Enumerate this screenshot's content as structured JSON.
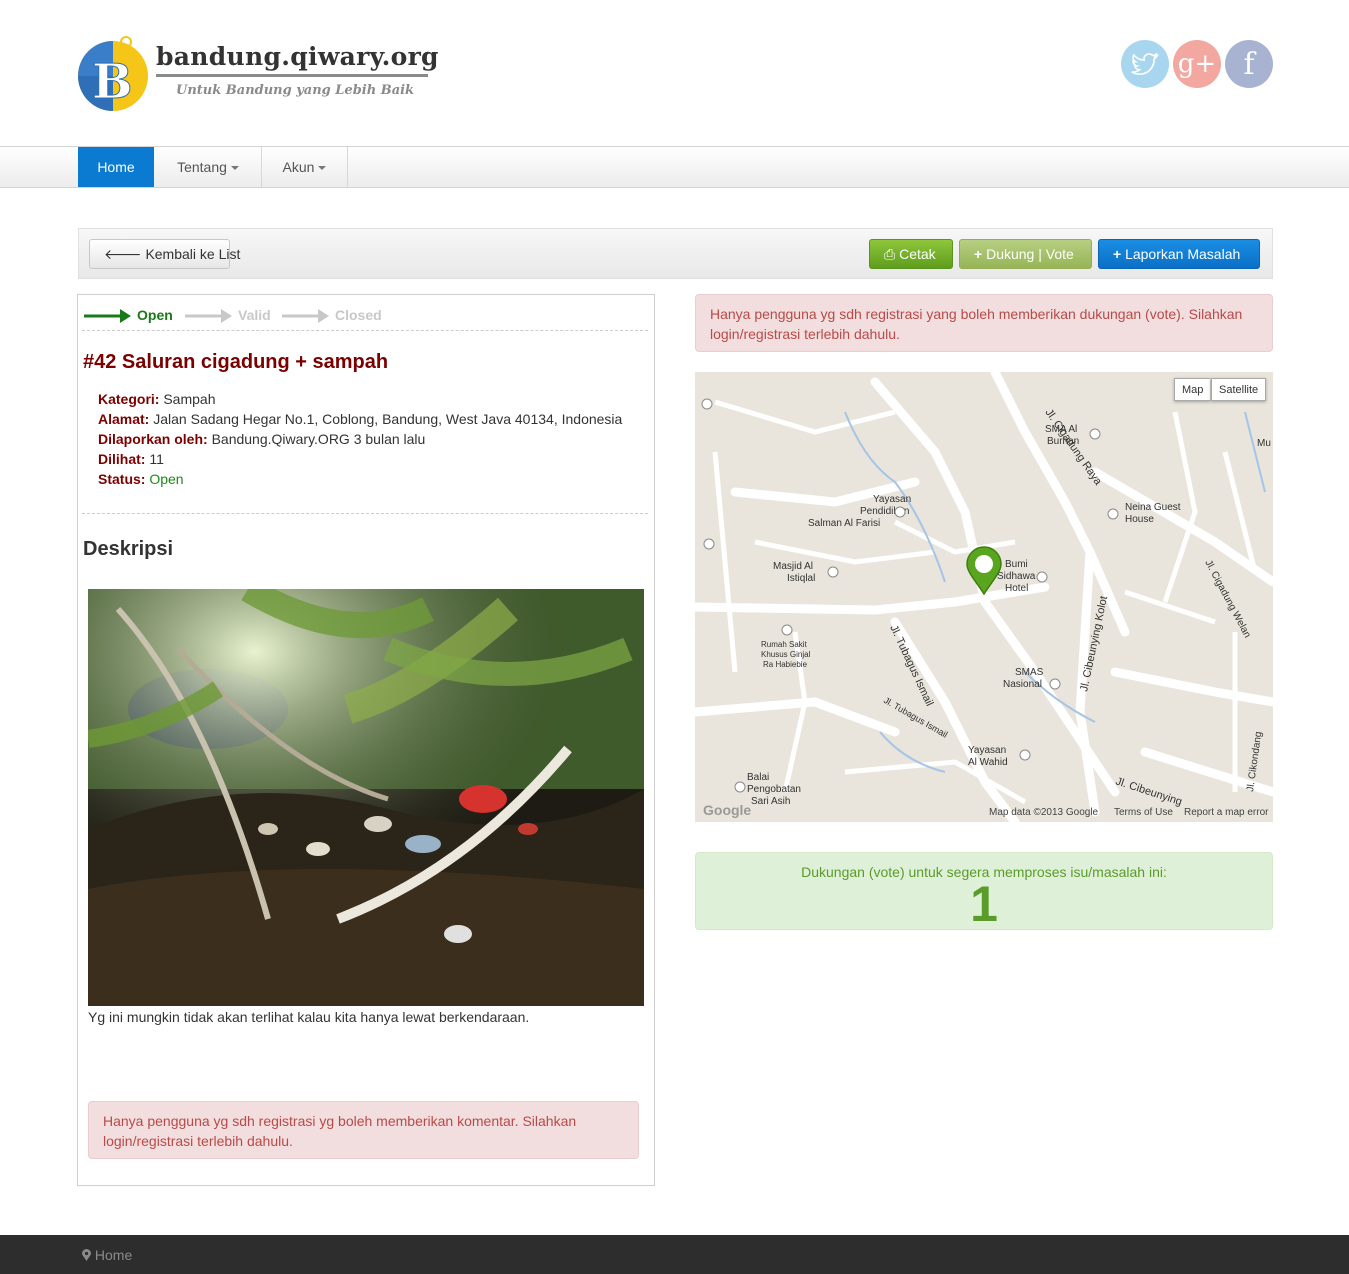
{
  "header": {
    "site_title": "bandung.qiwary.org",
    "tagline": "Untuk Bandung yang Lebih Baik",
    "social": {
      "twitter": "twitter-icon",
      "google_plus": "g+",
      "facebook": "f"
    }
  },
  "nav": {
    "home": "Home",
    "tentang": "Tentang",
    "akun": "Akun"
  },
  "toolbar": {
    "back": "Kembali ke List",
    "print": "Cetak",
    "vote": "Dukung | Vote",
    "report": "Laporkan Masalah"
  },
  "status_steps": [
    "Open",
    "Valid",
    "Closed"
  ],
  "issue": {
    "title": "#42 Saluran cigadung + sampah",
    "category_label": "Kategori:",
    "category": "Sampah",
    "address_label": "Alamat:",
    "address": "Jalan Sadang Hegar No.1, Coblong, Bandung, West Java 40134, Indonesia",
    "reported_label": "Dilaporkan oleh:",
    "reported": "Bandung.Qiwary.ORG 3 bulan lalu",
    "views_label": "Dilihat:",
    "views": "11",
    "status_label": "Status:",
    "status": "Open"
  },
  "description": {
    "heading": "Deskripsi",
    "caption": "Yg ini mungkin tidak akan terlihat kalau kita hanya lewat berkendaraan."
  },
  "comment_alert": "Hanya pengguna yg sdh registrasi yg boleh memberikan komentar. Silahkan login/registrasi terlebih dahulu.",
  "vote_alert": "Hanya pengguna yg sdh registrasi yang boleh memberikan dukungan (vote). Silahkan login/registrasi terlebih dahulu.",
  "map": {
    "type_map": "Map",
    "type_satellite": "Satellite",
    "data_credit": "Map data ©2013 Google",
    "terms": "Terms of Use",
    "report_error": "Report a map error",
    "labels": [
      "Jl. Cigadung Raya",
      "SMA Al Burhan",
      "Neina Guest House",
      "Yayasan Pendidikan Salman Al Farisi",
      "Masjid Al Istiqlal",
      "Bumi Sidhawa Hotel",
      "Jl. Cibeunying Kolot",
      "Jl. Cigadung Welan",
      "Rumah Sakit Khusus Ginjal Ra Habiebie",
      "Jl. Tubagus Ismail",
      "SMAS Nasional",
      "Yayasan Al Wahid",
      "Jl. Cikondang",
      "Balai Pengobatan Sari Asih",
      "Jl. Cibeunying"
    ]
  },
  "vote_box": {
    "text": "Dukungan (vote) untuk segera memproses isu/masalah ini:",
    "count": "1"
  },
  "footer": {
    "home": "Home"
  },
  "colors": {
    "brand_blue": "#0b7bd1",
    "issue_red": "#7b0000",
    "status_green": "#1a8a1a"
  }
}
